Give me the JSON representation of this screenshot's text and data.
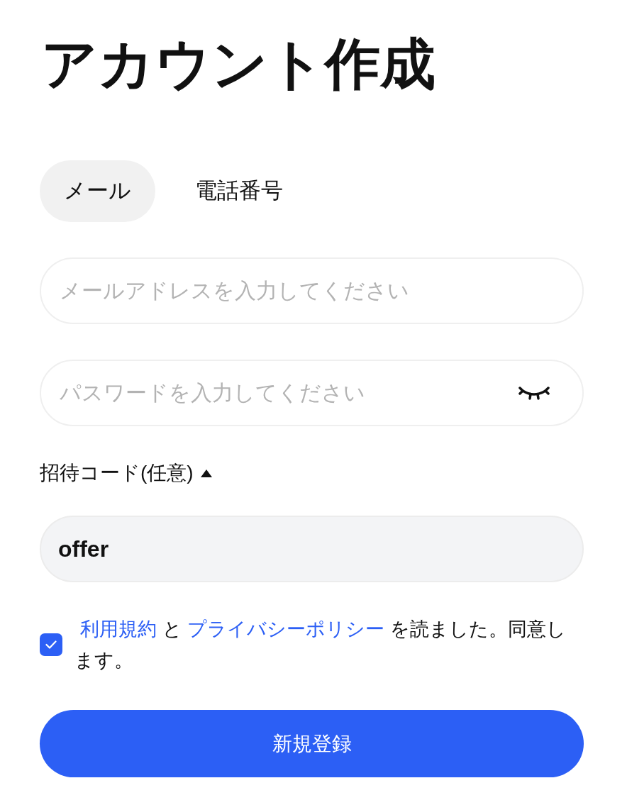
{
  "title": "アカウント作成",
  "tabs": [
    {
      "label": "メール",
      "selected": true
    },
    {
      "label": "電話番号",
      "selected": false
    }
  ],
  "email_field": {
    "placeholder": "メールアドレスを入力してください"
  },
  "password_field": {
    "placeholder": "パスワードを入力してください",
    "password_visible": false
  },
  "invite_code": {
    "label": "招待コード(任意)",
    "expanded": true,
    "value": "offer"
  },
  "agreement": {
    "checked": true,
    "segments": [
      {
        "kind": "link",
        "text": "利用規約"
      },
      {
        "kind": "text",
        "text": "と"
      },
      {
        "kind": "link",
        "text": "プライバシーポリシー"
      },
      {
        "kind": "text",
        "text": "を読ました。同意します。"
      }
    ]
  },
  "submit_button": {
    "label": "新規登録"
  }
}
